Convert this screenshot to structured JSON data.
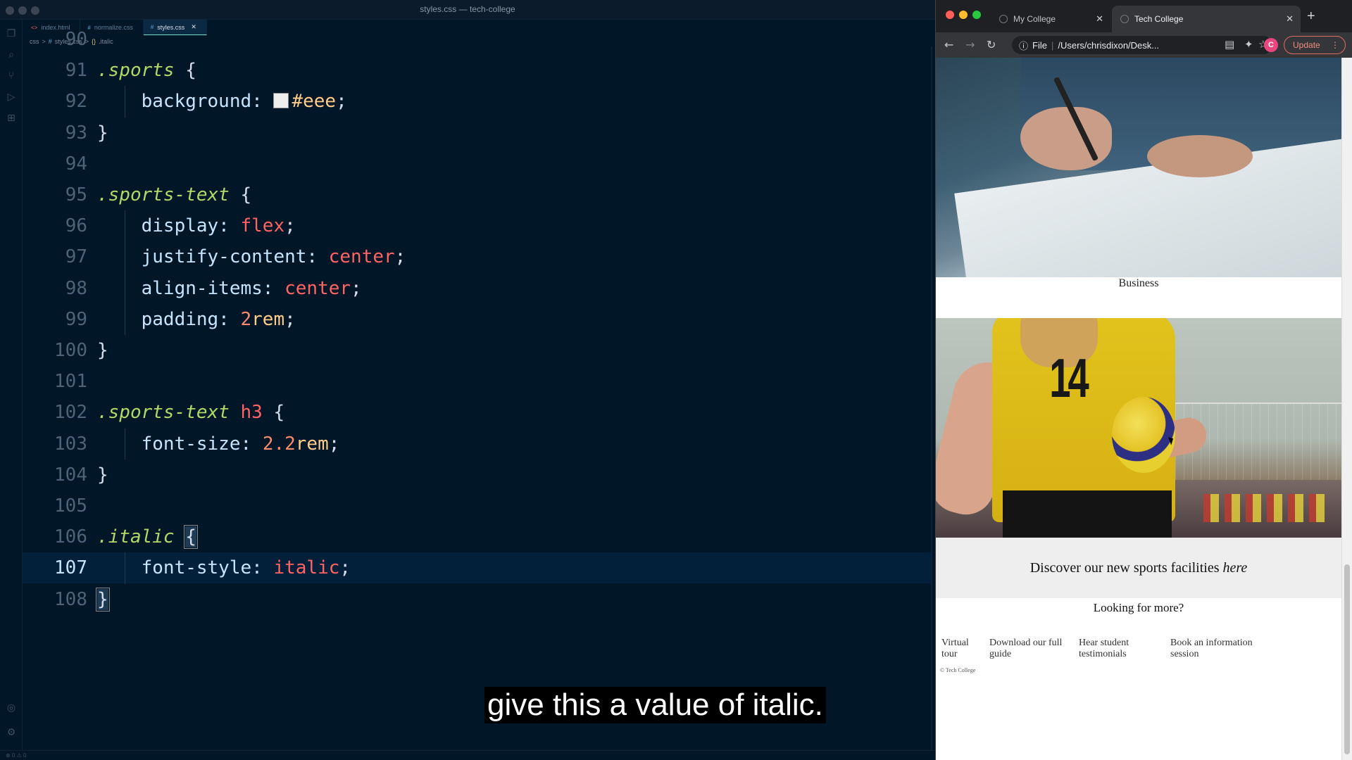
{
  "editor": {
    "window_title": "styles.css — tech-college",
    "tabs": [
      {
        "icon": "<>",
        "label": "index.html"
      },
      {
        "icon": "#",
        "label": "normalize.css"
      },
      {
        "icon": "#",
        "label": "styles.css"
      }
    ],
    "breadcrumb": [
      "css",
      ">",
      "#",
      "styles.css",
      ">",
      "{}",
      ".italic"
    ],
    "statusbar": "⊗ 0 ⚠ 0",
    "lines": [
      {
        "n": "90",
        "parts": [
          {
            "c": "punc",
            "t": ""
          }
        ]
      },
      {
        "n": "91",
        "parts": [
          {
            "c": "sel",
            "t": ".sports"
          },
          {
            "c": "punc",
            "t": " {"
          }
        ]
      },
      {
        "n": "92",
        "parts": [
          {
            "c": "prop",
            "t": "    background: "
          },
          {
            "c": "swatch",
            "t": ""
          },
          {
            "c": "hex",
            "t": "#eee"
          },
          {
            "c": "punc",
            "t": ";"
          }
        ]
      },
      {
        "n": "93",
        "parts": [
          {
            "c": "punc",
            "t": "}"
          }
        ]
      },
      {
        "n": "94",
        "parts": []
      },
      {
        "n": "95",
        "parts": [
          {
            "c": "sel",
            "t": ".sports-text"
          },
          {
            "c": "punc",
            "t": " {"
          }
        ]
      },
      {
        "n": "96",
        "parts": [
          {
            "c": "prop",
            "t": "    display: "
          },
          {
            "c": "val",
            "t": "flex"
          },
          {
            "c": "punc",
            "t": ";"
          }
        ]
      },
      {
        "n": "97",
        "parts": [
          {
            "c": "prop",
            "t": "    justify-content: "
          },
          {
            "c": "val",
            "t": "center"
          },
          {
            "c": "punc",
            "t": ";"
          }
        ]
      },
      {
        "n": "98",
        "parts": [
          {
            "c": "prop",
            "t": "    align-items: "
          },
          {
            "c": "val",
            "t": "center"
          },
          {
            "c": "punc",
            "t": ";"
          }
        ]
      },
      {
        "n": "99",
        "parts": [
          {
            "c": "prop",
            "t": "    padding: "
          },
          {
            "c": "num",
            "t": "2"
          },
          {
            "c": "unit",
            "t": "rem"
          },
          {
            "c": "punc",
            "t": ";"
          }
        ]
      },
      {
        "n": "100",
        "parts": [
          {
            "c": "punc",
            "t": "}"
          }
        ]
      },
      {
        "n": "101",
        "parts": []
      },
      {
        "n": "102",
        "parts": [
          {
            "c": "sel",
            "t": ".sports-text"
          },
          {
            "c": "tag",
            "t": " h3"
          },
          {
            "c": "punc",
            "t": " {"
          }
        ]
      },
      {
        "n": "103",
        "parts": [
          {
            "c": "prop",
            "t": "    font-size: "
          },
          {
            "c": "num",
            "t": "2.2"
          },
          {
            "c": "unit",
            "t": "rem"
          },
          {
            "c": "punc",
            "t": ";"
          }
        ]
      },
      {
        "n": "104",
        "parts": [
          {
            "c": "punc",
            "t": "}"
          }
        ]
      },
      {
        "n": "105",
        "parts": []
      },
      {
        "n": "106",
        "parts": [
          {
            "c": "sel",
            "t": ".italic"
          },
          {
            "c": "punc",
            "t": " "
          },
          {
            "c": "bracket",
            "t": "{"
          }
        ]
      },
      {
        "n": "107",
        "parts": [
          {
            "c": "prop",
            "t": "    font-style: "
          },
          {
            "c": "val",
            "t": "italic"
          },
          {
            "c": "punc",
            "t": ";"
          }
        ],
        "current": true
      },
      {
        "n": "108",
        "parts": [
          {
            "c": "bracket",
            "t": "}"
          }
        ]
      }
    ],
    "caption": "give this a value of italic."
  },
  "browser": {
    "tabs": [
      {
        "label": "My College",
        "active": false
      },
      {
        "label": "Tech College",
        "active": true
      }
    ],
    "new_tab": "+",
    "address_scheme": "File",
    "address_url": "/Users/chrisdixon/Desk...",
    "avatar_letter": "C",
    "update_label": "Update",
    "page": {
      "business_caption": "Business",
      "banner_text": "Discover our new sports facilities ",
      "banner_italic": "here",
      "more_title": "Looking for more?",
      "links": [
        {
          "label": "Virtual tour"
        },
        {
          "label": "Download our full guide"
        },
        {
          "label": "Hear student testimonials"
        },
        {
          "label": "Book an information session"
        }
      ],
      "footer": "© Tech College"
    }
  },
  "colors": {
    "editor_bg": "#011627",
    "selector": "#addb67",
    "property": "#c5e4fd",
    "value": "#ff6363",
    "number": "#f78c6c",
    "hex": "#ffcb8b",
    "banner_bg": "#eeeeee"
  }
}
